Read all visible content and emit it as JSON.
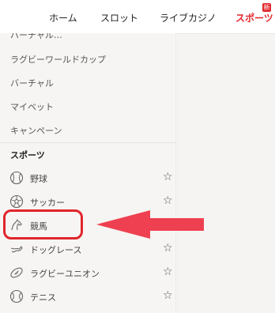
{
  "topnav": {
    "items": [
      {
        "label": "ホーム"
      },
      {
        "label": "スロット"
      },
      {
        "label": "ライブカジノ"
      },
      {
        "label": "スポーツ"
      }
    ],
    "new_badge": "新"
  },
  "menu": {
    "cut_item": "バーチャル…",
    "items": [
      {
        "label": "ラグビーワールドカップ"
      },
      {
        "label": "バーチャル"
      },
      {
        "label": "マイベット"
      },
      {
        "label": "キャンペーン"
      }
    ]
  },
  "sports": {
    "title": "スポーツ",
    "items": [
      {
        "label": "野球",
        "icon": "baseball-icon",
        "star": "☆"
      },
      {
        "label": "サッカー",
        "icon": "soccer-icon",
        "star": "☆"
      },
      {
        "label": "競馬",
        "icon": "horse-racing-icon",
        "star": "☆"
      },
      {
        "label": "ドッグレース",
        "icon": "greyhound-icon",
        "star": "☆"
      },
      {
        "label": "ラグビーユニオン",
        "icon": "rugby-ball-icon",
        "star": "☆"
      },
      {
        "label": "テニス",
        "icon": "tennis-ball-icon",
        "star": "☆"
      }
    ]
  },
  "colors": {
    "accent": "#e2262b",
    "annotation": "#e0252c"
  }
}
